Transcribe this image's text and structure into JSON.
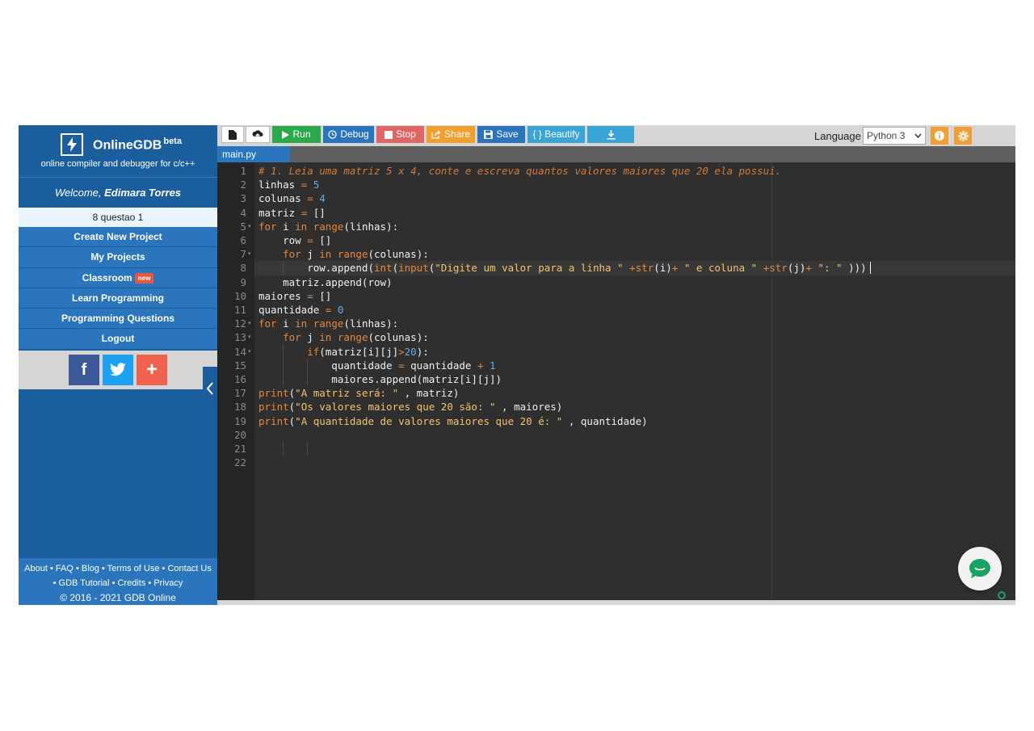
{
  "brand": {
    "name": "OnlineGDB",
    "beta": "beta",
    "tagline": "online compiler and debugger for c/c++"
  },
  "welcome": {
    "prefix": "Welcome,",
    "user": "Edimara Torres"
  },
  "project": {
    "name": "8 questao 1"
  },
  "menu": {
    "items": [
      {
        "label": "Create New Project"
      },
      {
        "label": "My Projects"
      },
      {
        "label": "Classroom",
        "badge": "new"
      },
      {
        "label": "Learn Programming"
      },
      {
        "label": "Programming Questions"
      },
      {
        "label": "Logout"
      }
    ]
  },
  "social": {
    "facebook_icon": "f",
    "plus_icon": "+"
  },
  "footer": {
    "links_row1": [
      "About",
      "FAQ",
      "Blog",
      "Terms of Use",
      "Contact Us"
    ],
    "links_row2": [
      "GDB Tutorial",
      "Credits",
      "Privacy"
    ],
    "separator": "•",
    "copyright": "© 2016 - 2021 GDB Online"
  },
  "toolbar": {
    "run": "Run",
    "debug": "Debug",
    "stop": "Stop",
    "share": "Share",
    "save": "Save",
    "beautify": "{ } Beautify",
    "language_label": "Language",
    "language_value": "Python 3",
    "colors": {
      "run": "#2aa84a",
      "debug": "#2a75bb",
      "stop": "#e06666",
      "share": "#f0a030",
      "save": "#2a75bb",
      "beautify": "#3aa4d6",
      "download": "#3aa4d6"
    }
  },
  "editor": {
    "tab_name": "main.py",
    "active_line": 8,
    "line_numbers": [
      "1",
      "2",
      "3",
      "4",
      "5",
      "6",
      "7",
      "8",
      "9",
      "10",
      "11",
      "12",
      "13",
      "14",
      "15",
      "16",
      "17",
      "18",
      "19",
      "20",
      "21",
      "22"
    ],
    "fold_lines": [
      5,
      7,
      12,
      13,
      14
    ],
    "lines": [
      [
        [
          "tk-comment",
          "# 1. Leia uma matriz 5 x 4, conte e escreva quantos valores maiores que 20 ela possui."
        ]
      ],
      [
        [
          "tk-id",
          "linhas "
        ],
        [
          "tk-op",
          "="
        ],
        [
          "tk-id",
          " "
        ],
        [
          "tk-num",
          "5"
        ]
      ],
      [
        [
          "tk-id",
          "colunas "
        ],
        [
          "tk-op",
          "="
        ],
        [
          "tk-id",
          " "
        ],
        [
          "tk-num",
          "4"
        ]
      ],
      [
        [
          "tk-id",
          "matriz "
        ],
        [
          "tk-op",
          "="
        ],
        [
          "tk-id",
          " []"
        ]
      ],
      [
        [
          "tk-kw",
          "for"
        ],
        [
          "tk-id",
          " i "
        ],
        [
          "tk-kw",
          "in"
        ],
        [
          "tk-id",
          " "
        ],
        [
          "tk-fn",
          "range"
        ],
        [
          "tk-id",
          "(linhas):"
        ]
      ],
      [
        [
          "tk-id",
          "    row "
        ],
        [
          "tk-op",
          "="
        ],
        [
          "tk-id",
          " []"
        ]
      ],
      [
        [
          "tk-id",
          "    "
        ],
        [
          "tk-kw",
          "for"
        ],
        [
          "tk-id",
          " j "
        ],
        [
          "tk-kw",
          "in"
        ],
        [
          "tk-id",
          " "
        ],
        [
          "tk-fn",
          "range"
        ],
        [
          "tk-id",
          "(colunas):"
        ]
      ],
      [
        [
          "tk-id",
          "        row.append("
        ],
        [
          "tk-fn",
          "int"
        ],
        [
          "tk-id",
          "("
        ],
        [
          "tk-fn",
          "input"
        ],
        [
          "tk-id",
          "("
        ],
        [
          "tk-str",
          "\"Digite um valor para a linha \""
        ],
        [
          "tk-id",
          " "
        ],
        [
          "tk-op",
          "+"
        ],
        [
          "tk-fn",
          "str"
        ],
        [
          "tk-id",
          "(i)"
        ],
        [
          "tk-op",
          "+"
        ],
        [
          "tk-id",
          " "
        ],
        [
          "tk-str",
          "\" e coluna \""
        ],
        [
          "tk-id",
          " "
        ],
        [
          "tk-op",
          "+"
        ],
        [
          "tk-fn",
          "str"
        ],
        [
          "tk-id",
          "(j)"
        ],
        [
          "tk-op",
          "+"
        ],
        [
          "tk-id",
          " "
        ],
        [
          "tk-str",
          "\": \""
        ],
        [
          "tk-id",
          " )))"
        ]
      ],
      [
        [
          "tk-id",
          "    matriz.append(row)"
        ]
      ],
      [
        [
          "tk-id",
          "maiores "
        ],
        [
          "tk-op",
          "="
        ],
        [
          "tk-id",
          " []"
        ]
      ],
      [
        [
          "tk-id",
          "quantidade "
        ],
        [
          "tk-op",
          "="
        ],
        [
          "tk-id",
          " "
        ],
        [
          "tk-num",
          "0"
        ]
      ],
      [
        [
          "tk-kw",
          "for"
        ],
        [
          "tk-id",
          " i "
        ],
        [
          "tk-kw",
          "in"
        ],
        [
          "tk-id",
          " "
        ],
        [
          "tk-fn",
          "range"
        ],
        [
          "tk-id",
          "(linhas):"
        ]
      ],
      [
        [
          "tk-id",
          "    "
        ],
        [
          "tk-kw",
          "for"
        ],
        [
          "tk-id",
          " j "
        ],
        [
          "tk-kw",
          "in"
        ],
        [
          "tk-id",
          " "
        ],
        [
          "tk-fn",
          "range"
        ],
        [
          "tk-id",
          "(colunas):"
        ]
      ],
      [
        [
          "tk-id",
          "        "
        ],
        [
          "tk-kw",
          "if"
        ],
        [
          "tk-id",
          "(matriz[i][j]"
        ],
        [
          "tk-op",
          ">"
        ],
        [
          "tk-num",
          "20"
        ],
        [
          "tk-id",
          "):"
        ]
      ],
      [
        [
          "tk-id",
          "            quantidade "
        ],
        [
          "tk-op",
          "="
        ],
        [
          "tk-id",
          " quantidade "
        ],
        [
          "tk-op",
          "+"
        ],
        [
          "tk-id",
          " "
        ],
        [
          "tk-num",
          "1"
        ]
      ],
      [
        [
          "tk-id",
          "            maiores.append(matriz[i][j])"
        ]
      ],
      [
        [
          "tk-fn",
          "print"
        ],
        [
          "tk-id",
          "("
        ],
        [
          "tk-str",
          "\"A matriz será: \""
        ],
        [
          "tk-id",
          " , matriz)"
        ]
      ],
      [
        [
          "tk-fn",
          "print"
        ],
        [
          "tk-id",
          "("
        ],
        [
          "tk-str",
          "\"Os valores maiores que 20 são: \""
        ],
        [
          "tk-id",
          " , maiores)"
        ]
      ],
      [
        [
          "tk-fn",
          "print"
        ],
        [
          "tk-id",
          "("
        ],
        [
          "tk-str",
          "\"A quantidade de valores maiores que 20 é: \""
        ],
        [
          "tk-id",
          " , quantidade)"
        ]
      ],
      [],
      [],
      []
    ]
  },
  "icons": {
    "new_file": "new-file-icon",
    "upload": "upload-icon",
    "run": "play-icon",
    "debug": "debug-icon",
    "stop": "stop-icon",
    "share": "share-icon",
    "save": "floppy-icon",
    "download": "download-icon",
    "info": "info-icon",
    "settings": "gear-icon",
    "collapse": "chevron-left-icon",
    "chat": "chat-icon"
  }
}
